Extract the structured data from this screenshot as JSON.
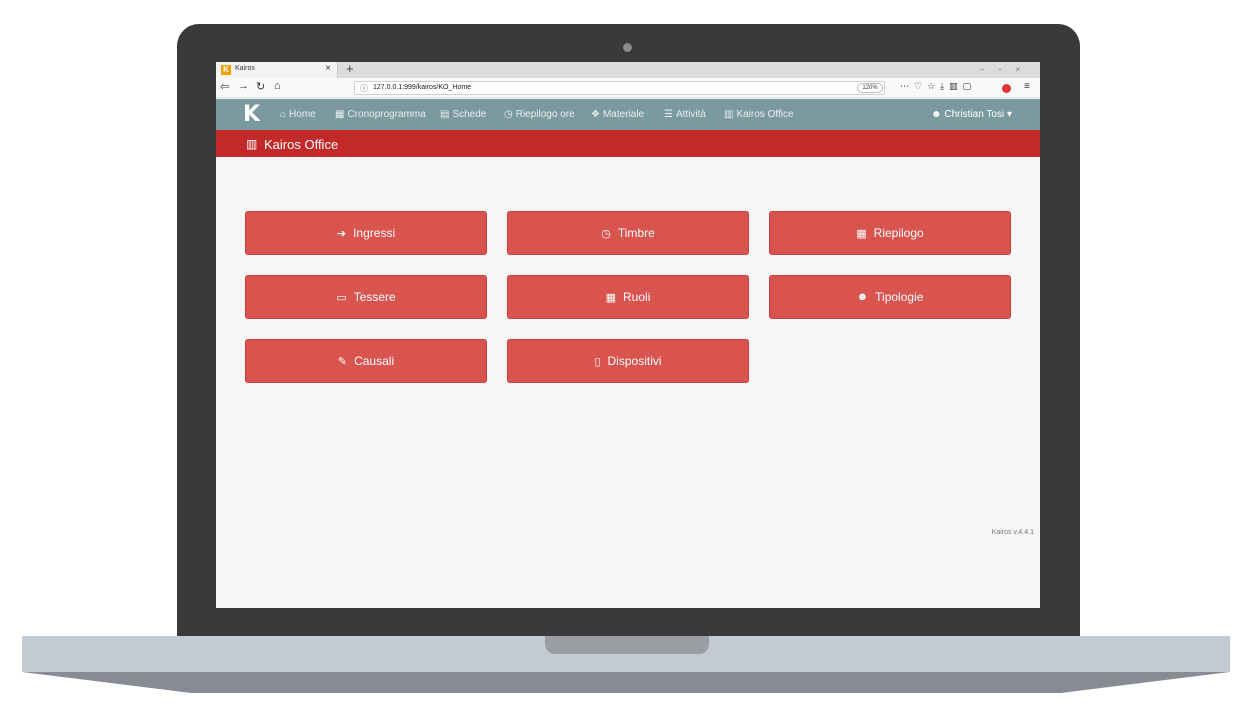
{
  "browser": {
    "tab_title": "Kairos",
    "tab_favicon_letter": "K",
    "tab_close": "×",
    "new_tab": "+",
    "url": "127.0.0.1:999/kairos/KO_Home",
    "zoom": "120%"
  },
  "app": {
    "brand": "K",
    "nav": [
      {
        "label": "Home",
        "icon": "home-icon"
      },
      {
        "label": "Cronoprogramma",
        "icon": "calendar-icon"
      },
      {
        "label": "Schede",
        "icon": "file-icon"
      },
      {
        "label": "Riepilogo ore",
        "icon": "clock-icon"
      },
      {
        "label": "Materiale",
        "icon": "cubes-icon"
      },
      {
        "label": "Attività",
        "icon": "list-icon"
      },
      {
        "label": "Kairos Office",
        "icon": "building-icon"
      }
    ],
    "user": "Christian Tosi"
  },
  "page": {
    "title": "Kairos Office",
    "buttons": [
      {
        "label": "Ingressi",
        "icon": "sign-in-icon"
      },
      {
        "label": "Timbre",
        "icon": "clock-icon"
      },
      {
        "label": "Riepilogo",
        "icon": "table-icon"
      },
      {
        "label": "Tessere",
        "icon": "id-card-icon"
      },
      {
        "label": "Ruoli",
        "icon": "calendar-icon"
      },
      {
        "label": "Tipologie",
        "icon": "users-icon"
      },
      {
        "label": "Causali",
        "icon": "brush-icon"
      },
      {
        "label": "Dispositivi",
        "icon": "mobile-icon"
      }
    ],
    "version": "Kairos v.4.4.1"
  },
  "colors": {
    "navbar": "#7b9aa0",
    "header": "#c4292a",
    "button": "#d9534f"
  }
}
